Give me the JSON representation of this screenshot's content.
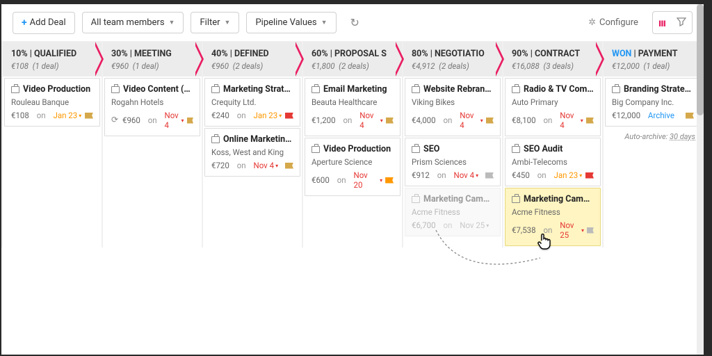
{
  "toolbar": {
    "add_deal": "Add Deal",
    "team_filter": "All team members",
    "filter": "Filter",
    "pipeline_values": "Pipeline Values",
    "configure": "Configure"
  },
  "auto_archive": {
    "label": "Auto-archive:",
    "days": "30 days"
  },
  "stages": [
    {
      "pct": "10%",
      "name": "QUALIFIED",
      "total": "€108",
      "count": "(1 deal)"
    },
    {
      "pct": "30%",
      "name": "MEETING",
      "total": "€960",
      "count": "(1 deal)"
    },
    {
      "pct": "40%",
      "name": "DEFINED",
      "total": "€960",
      "count": "(2 deals)"
    },
    {
      "pct": "60%",
      "name": "PROPOSAL S",
      "total": "€1,800",
      "count": "(2 deals)"
    },
    {
      "pct": "80%",
      "name": "NEGOTIATIO",
      "total": "€4,912",
      "count": "(2 deals)"
    },
    {
      "pct": "90%",
      "name": "CONTRACT",
      "total": "€16,088",
      "count": "(3 deals)"
    },
    {
      "pct": "WON",
      "name": "PAYMENT",
      "total": "€12,000",
      "count": "(1 deal)",
      "won": true
    }
  ],
  "cards": {
    "c0": [
      {
        "title": "Video Production",
        "org": "Rouleau Banque",
        "value": "€108",
        "on": "on",
        "date": "Jan 23",
        "dateColor": "orange",
        "flag": "gold"
      }
    ],
    "c1": [
      {
        "title": "Video Content (M...",
        "org": "Rogahn Hotels",
        "value": "€960",
        "on": "on",
        "date": "Nov 4",
        "dateColor": "red",
        "flag": "gold",
        "swap": true
      }
    ],
    "c2": [
      {
        "title": "Marketing Strategy",
        "org": "Crequity Ltd.",
        "value": "€240",
        "on": "on",
        "date": "Jan 23",
        "dateColor": "orange",
        "flag": "red"
      },
      {
        "title": "Online Marketing ...",
        "org": "Koss, West and King",
        "value": "€720",
        "on": "on",
        "date": "Nov 4",
        "dateColor": "red",
        "flag": "gold"
      }
    ],
    "c3": [
      {
        "title": "Email Marketing",
        "org": "Beauta Healthcare",
        "value": "€1,200",
        "on": "on",
        "date": "Nov 4",
        "dateColor": "red",
        "flag": "gold"
      },
      {
        "title": "Video Production",
        "org": "Aperture Science",
        "value": "€600",
        "on": "on",
        "date": "Nov 20",
        "dateColor": "red",
        "flag": "orange"
      }
    ],
    "c4": [
      {
        "title": "Website Rebrandi...",
        "org": "Viking Bikes",
        "value": "€4,000",
        "on": "on",
        "date": "Nov 4",
        "dateColor": "red",
        "flag": "gold"
      },
      {
        "title": "SEO",
        "org": "Prism Sciences",
        "value": "€912",
        "on": "on",
        "date": "Nov 4",
        "dateColor": "red",
        "flag": "gray"
      },
      {
        "title": "Marketing Campa...",
        "org": "Acme Fitness",
        "value": "€6,700",
        "on": "on",
        "date": "Nov 25",
        "dateColor": "gray",
        "flag": "",
        "ghost": true
      }
    ],
    "c5": [
      {
        "title": "Radio & TV Comm...",
        "org": "Auto Primary",
        "value": "€8,100",
        "on": "on",
        "date": "Nov 4",
        "dateColor": "red",
        "flag": "gold"
      },
      {
        "title": "SEO Audit",
        "org": "Ambi-Telecoms",
        "value": "€450",
        "on": "on",
        "date": "Jan 23",
        "dateColor": "orange",
        "flag": "red"
      },
      {
        "title": "Marketing Campa...",
        "org": "Acme Fitness",
        "value": "€7,538",
        "on": "on",
        "date": "Nov 25",
        "dateColor": "red",
        "flag": "gray",
        "drag": true
      }
    ],
    "c6": [
      {
        "title": "Branding Strategy",
        "org": "Big Company Inc.",
        "value": "€12,000",
        "archive": "Archive",
        "flag": "gold"
      }
    ]
  }
}
